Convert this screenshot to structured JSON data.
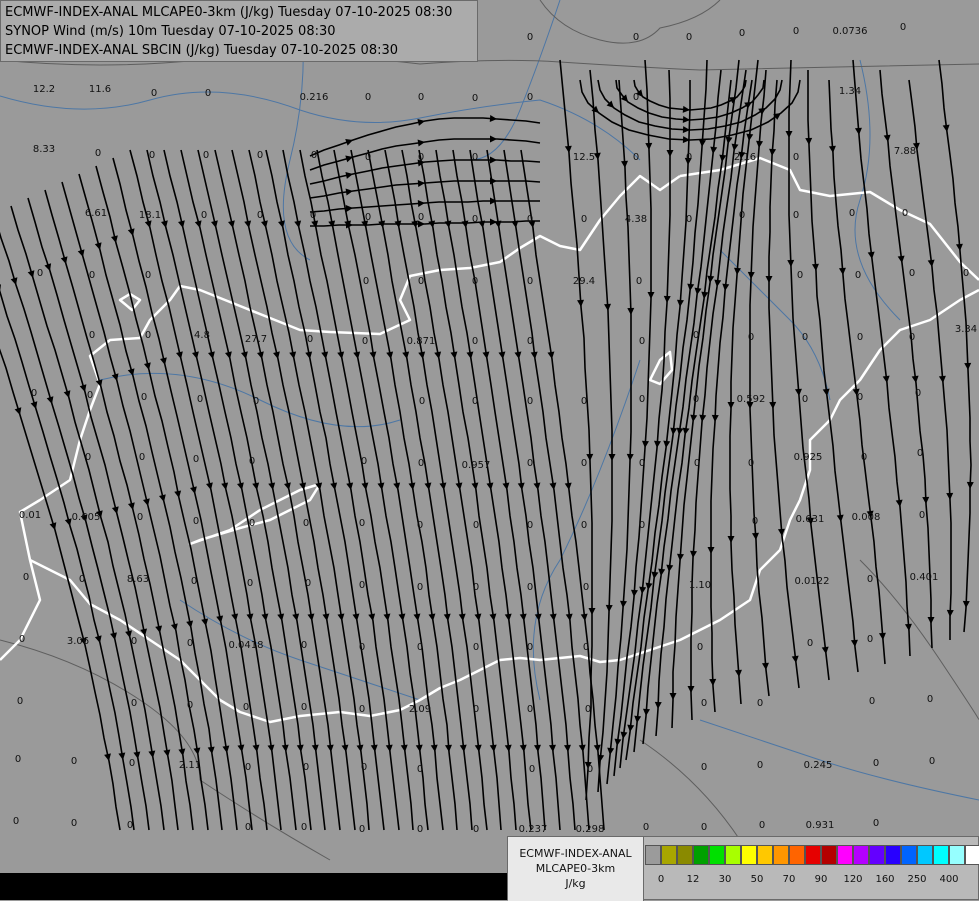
{
  "header": {
    "lines": [
      "ECMWF-INDEX-ANAL MLCAPE0-3km (J/kg) Tuesday 07-10-2025 08:30",
      "SYNOP Wind (m/s) 10m Tuesday 07-10-2025 08:30",
      "ECMWF-INDEX-ANAL SBCIN (J/kg) Tuesday 07-10-2025 08:30"
    ]
  },
  "legend": {
    "title_lines": [
      "ECMWF-INDEX-ANAL",
      "MLCAPE0-3km",
      "J/kg"
    ],
    "swatch_colors": [
      "#9b9b9b",
      "#a8a600",
      "#8a8a00",
      "#00a000",
      "#00e000",
      "#a8ff00",
      "#ffff00",
      "#ffc800",
      "#ff9600",
      "#ff6400",
      "#e60000",
      "#b40000",
      "#ff00ff",
      "#b400ff",
      "#6400ff",
      "#2800ff",
      "#0064ff",
      "#00c8ff",
      "#00ffff",
      "#96ffff",
      "#ffffff"
    ],
    "ticks": [
      "0",
      "12",
      "30",
      "50",
      "70",
      "90",
      "120",
      "160",
      "250",
      "400"
    ]
  },
  "map_values": [
    "12.2",
    "11.6",
    "0",
    "0",
    "0.216",
    "0",
    "0",
    "0",
    "0",
    "0",
    "0",
    "0",
    "0",
    "0",
    "0",
    "0",
    "0",
    "0.0736",
    "0",
    "8.33",
    "0",
    "0",
    "0",
    "0",
    "0",
    "0",
    "0",
    "0",
    "12.5",
    "0",
    "0",
    "2.16",
    "0",
    "0",
    "1.34",
    "7.88",
    "6.61",
    "18.1",
    "0",
    "0",
    "0",
    "0",
    "0",
    "0",
    "0",
    "0",
    "4.38",
    "0",
    "0",
    "0",
    "0",
    "0",
    "0",
    "0",
    "0",
    "0",
    "0",
    "0",
    "0",
    "29.4",
    "0",
    "0",
    "0",
    "0",
    "0",
    "0",
    "0",
    "4.8",
    "27.7",
    "0",
    "0",
    "0.871",
    "0",
    "0",
    "0",
    "0",
    "0",
    "0",
    "0",
    "0",
    "3.34",
    "0",
    "0",
    "0",
    "0",
    "0",
    "0",
    "0",
    "0",
    "0",
    "0",
    "0",
    "0.592",
    "0",
    "0",
    "0",
    "0",
    "0",
    "0",
    "0",
    "0",
    "0",
    "0.957",
    "0",
    "0",
    "0",
    "0",
    "0",
    "0.925",
    "0",
    "0",
    "0.01",
    "0.605",
    "0",
    "0",
    "0",
    "0",
    "0",
    "0",
    "0",
    "0",
    "0",
    "0",
    "0",
    "0.631",
    "0.008",
    "0",
    "0",
    "0",
    "8.63",
    "0",
    "0",
    "0",
    "0",
    "0",
    "0",
    "0",
    "0",
    "1.10",
    "0.0122",
    "0",
    "0.401",
    "0",
    "3.06",
    "0",
    "0",
    "0.0418",
    "0",
    "0",
    "0",
    "0",
    "0",
    "0",
    "0",
    "0",
    "0",
    "0",
    "0",
    "0",
    "0",
    "0",
    "0",
    "2.09",
    "0",
    "0",
    "0",
    "0",
    "0",
    "0",
    "0",
    "0",
    "0",
    "0",
    "2.11",
    "0",
    "0",
    "0",
    "0",
    "0",
    "0",
    "0",
    "0",
    "0.245",
    "0",
    "0",
    "0",
    "0",
    "0",
    "0",
    "0",
    "0",
    "0",
    "0",
    "0.237",
    "0.298",
    "0",
    "0",
    "0",
    "0.931",
    "0",
    "0",
    "0",
    "0",
    "0",
    "0"
  ]
}
